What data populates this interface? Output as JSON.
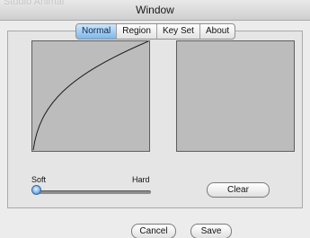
{
  "window": {
    "title": "Window",
    "background_title_fragment": "Studio Animal"
  },
  "tabs": [
    {
      "label": "Normal",
      "selected": true
    },
    {
      "label": "Region",
      "selected": false
    },
    {
      "label": "Key Set",
      "selected": false
    },
    {
      "label": "About",
      "selected": false
    }
  ],
  "slider": {
    "min_label": "Soft",
    "max_label": "Hard",
    "value": 0.0
  },
  "buttons": {
    "clear": "Clear",
    "cancel": "Cancel",
    "save": "Save"
  },
  "colors": {
    "selected_tab": "#7fb6ea",
    "curve_area": "#bcbcbc",
    "slider_thumb": "#3a7cc4"
  }
}
